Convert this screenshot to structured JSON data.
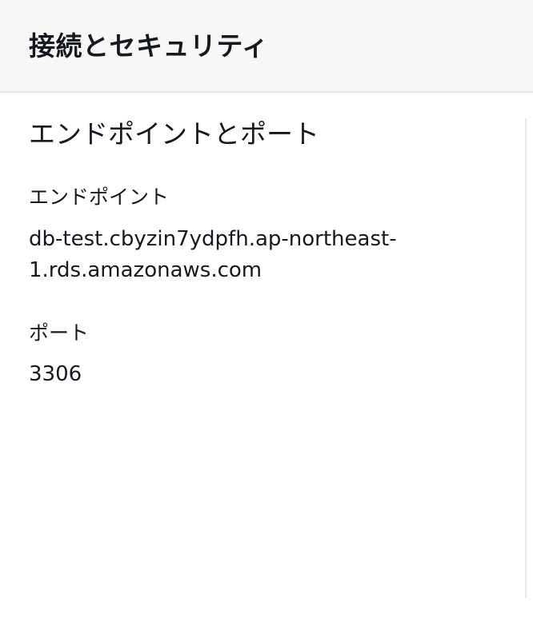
{
  "panel": {
    "title": "接続とセキュリティ"
  },
  "section": {
    "heading": "エンドポイントとポート"
  },
  "fields": {
    "endpoint": {
      "label": "エンドポイント",
      "value_line1": "db-test.cbyzin7ydpfh.ap-northeast-",
      "value_line2": "1.rds.amazonaws.com"
    },
    "port": {
      "label": "ポート",
      "value": "3306"
    }
  }
}
